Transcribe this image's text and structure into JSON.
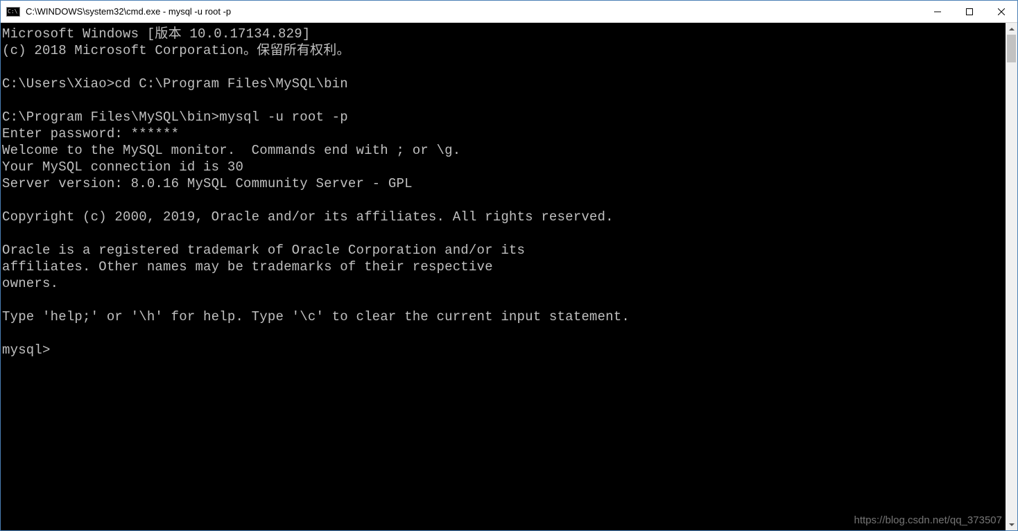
{
  "titlebar": {
    "title": "C:\\WINDOWS\\system32\\cmd.exe - mysql  -u root -p"
  },
  "console": {
    "lines": [
      "Microsoft Windows [版本 10.0.17134.829]",
      "(c) 2018 Microsoft Corporation。保留所有权利。",
      "",
      "C:\\Users\\Xiao>cd C:\\Program Files\\MySQL\\bin",
      "",
      "C:\\Program Files\\MySQL\\bin>mysql -u root -p",
      "Enter password: ******",
      "Welcome to the MySQL monitor.  Commands end with ; or \\g.",
      "Your MySQL connection id is 30",
      "Server version: 8.0.16 MySQL Community Server - GPL",
      "",
      "Copyright (c) 2000, 2019, Oracle and/or its affiliates. All rights reserved.",
      "",
      "Oracle is a registered trademark of Oracle Corporation and/or its",
      "affiliates. Other names may be trademarks of their respective",
      "owners.",
      "",
      "Type 'help;' or '\\h' for help. Type '\\c' to clear the current input statement.",
      "",
      "mysql>"
    ]
  },
  "watermark": "https://blog.csdn.net/qq_373507"
}
